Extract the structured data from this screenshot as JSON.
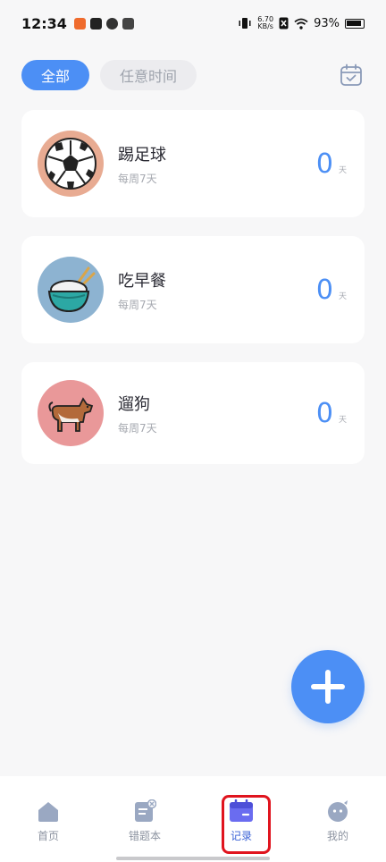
{
  "status_bar": {
    "time": "12:34",
    "net_speed_value": "6.70",
    "net_speed_unit": "KB/s",
    "battery": "93%"
  },
  "filters": {
    "active": "全部",
    "inactive": "任意时间"
  },
  "habits": [
    {
      "title": "踢足球",
      "frequency": "每周7天",
      "count": "0",
      "unit": "天",
      "icon": "soccer-ball-icon",
      "color": "#e8ab92"
    },
    {
      "title": "吃早餐",
      "frequency": "每周7天",
      "count": "0",
      "unit": "天",
      "icon": "rice-bowl-icon",
      "color": "#8db3d1"
    },
    {
      "title": "遛狗",
      "frequency": "每周7天",
      "count": "0",
      "unit": "天",
      "icon": "dog-icon",
      "color": "#e99899"
    }
  ],
  "tabs": [
    {
      "label": "首页",
      "icon": "home-icon"
    },
    {
      "label": "错题本",
      "icon": "notebook-icon"
    },
    {
      "label": "记录",
      "icon": "calendar-icon"
    },
    {
      "label": "我的",
      "icon": "profile-icon"
    }
  ],
  "colors": {
    "accent": "#4c8ff5",
    "highlight": "#e0141e"
  }
}
